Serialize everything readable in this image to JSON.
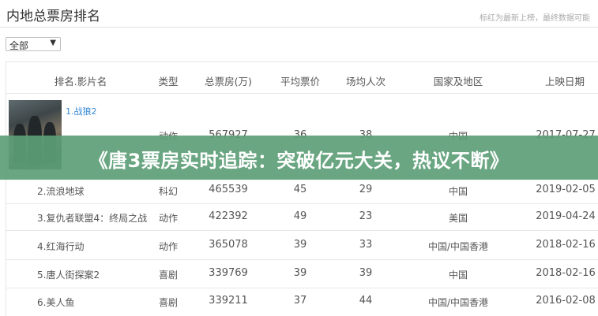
{
  "header": {
    "title": "内地总票房排名",
    "note": "标红为最新上榜，最终数据可能"
  },
  "filter": {
    "selected": "全部"
  },
  "table": {
    "columns": [
      "排名.影片名",
      "类型",
      "总票房(万)",
      "平均票价",
      "场均人次",
      "国家及地区",
      "上映日期"
    ],
    "rows": [
      {
        "title": "1.战狼2",
        "genre": "动作",
        "box_office": "567927",
        "avg_price": "36",
        "avg_people": "38",
        "region": "中国",
        "release": "2017-07-27"
      },
      {
        "title": "2.流浪地球",
        "genre": "科幻",
        "box_office": "465539",
        "avg_price": "45",
        "avg_people": "29",
        "region": "中国",
        "release": "2019-02-05"
      },
      {
        "title": "3.复仇者联盟4：终局之战",
        "genre": "动作",
        "box_office": "422392",
        "avg_price": "49",
        "avg_people": "23",
        "region": "美国",
        "release": "2019-04-24"
      },
      {
        "title": "4.红海行动",
        "genre": "动作",
        "box_office": "365078",
        "avg_price": "39",
        "avg_people": "33",
        "region": "中国/中国香港",
        "release": "2018-02-16"
      },
      {
        "title": "5.唐人街探案2",
        "genre": "喜剧",
        "box_office": "339769",
        "avg_price": "39",
        "avg_people": "39",
        "region": "中国",
        "release": "2018-02-16"
      },
      {
        "title": "6.美人鱼",
        "genre": "喜剧",
        "box_office": "339211",
        "avg_price": "37",
        "avg_people": "44",
        "region": "中国/中国香港",
        "release": "2016-02-08"
      }
    ]
  },
  "banner": {
    "text": "《唐3票房实时追踪：突破亿元大关，热议不断》"
  },
  "colors": {
    "banner_bg": "#5c9e76",
    "link": "#3a8bd6"
  }
}
